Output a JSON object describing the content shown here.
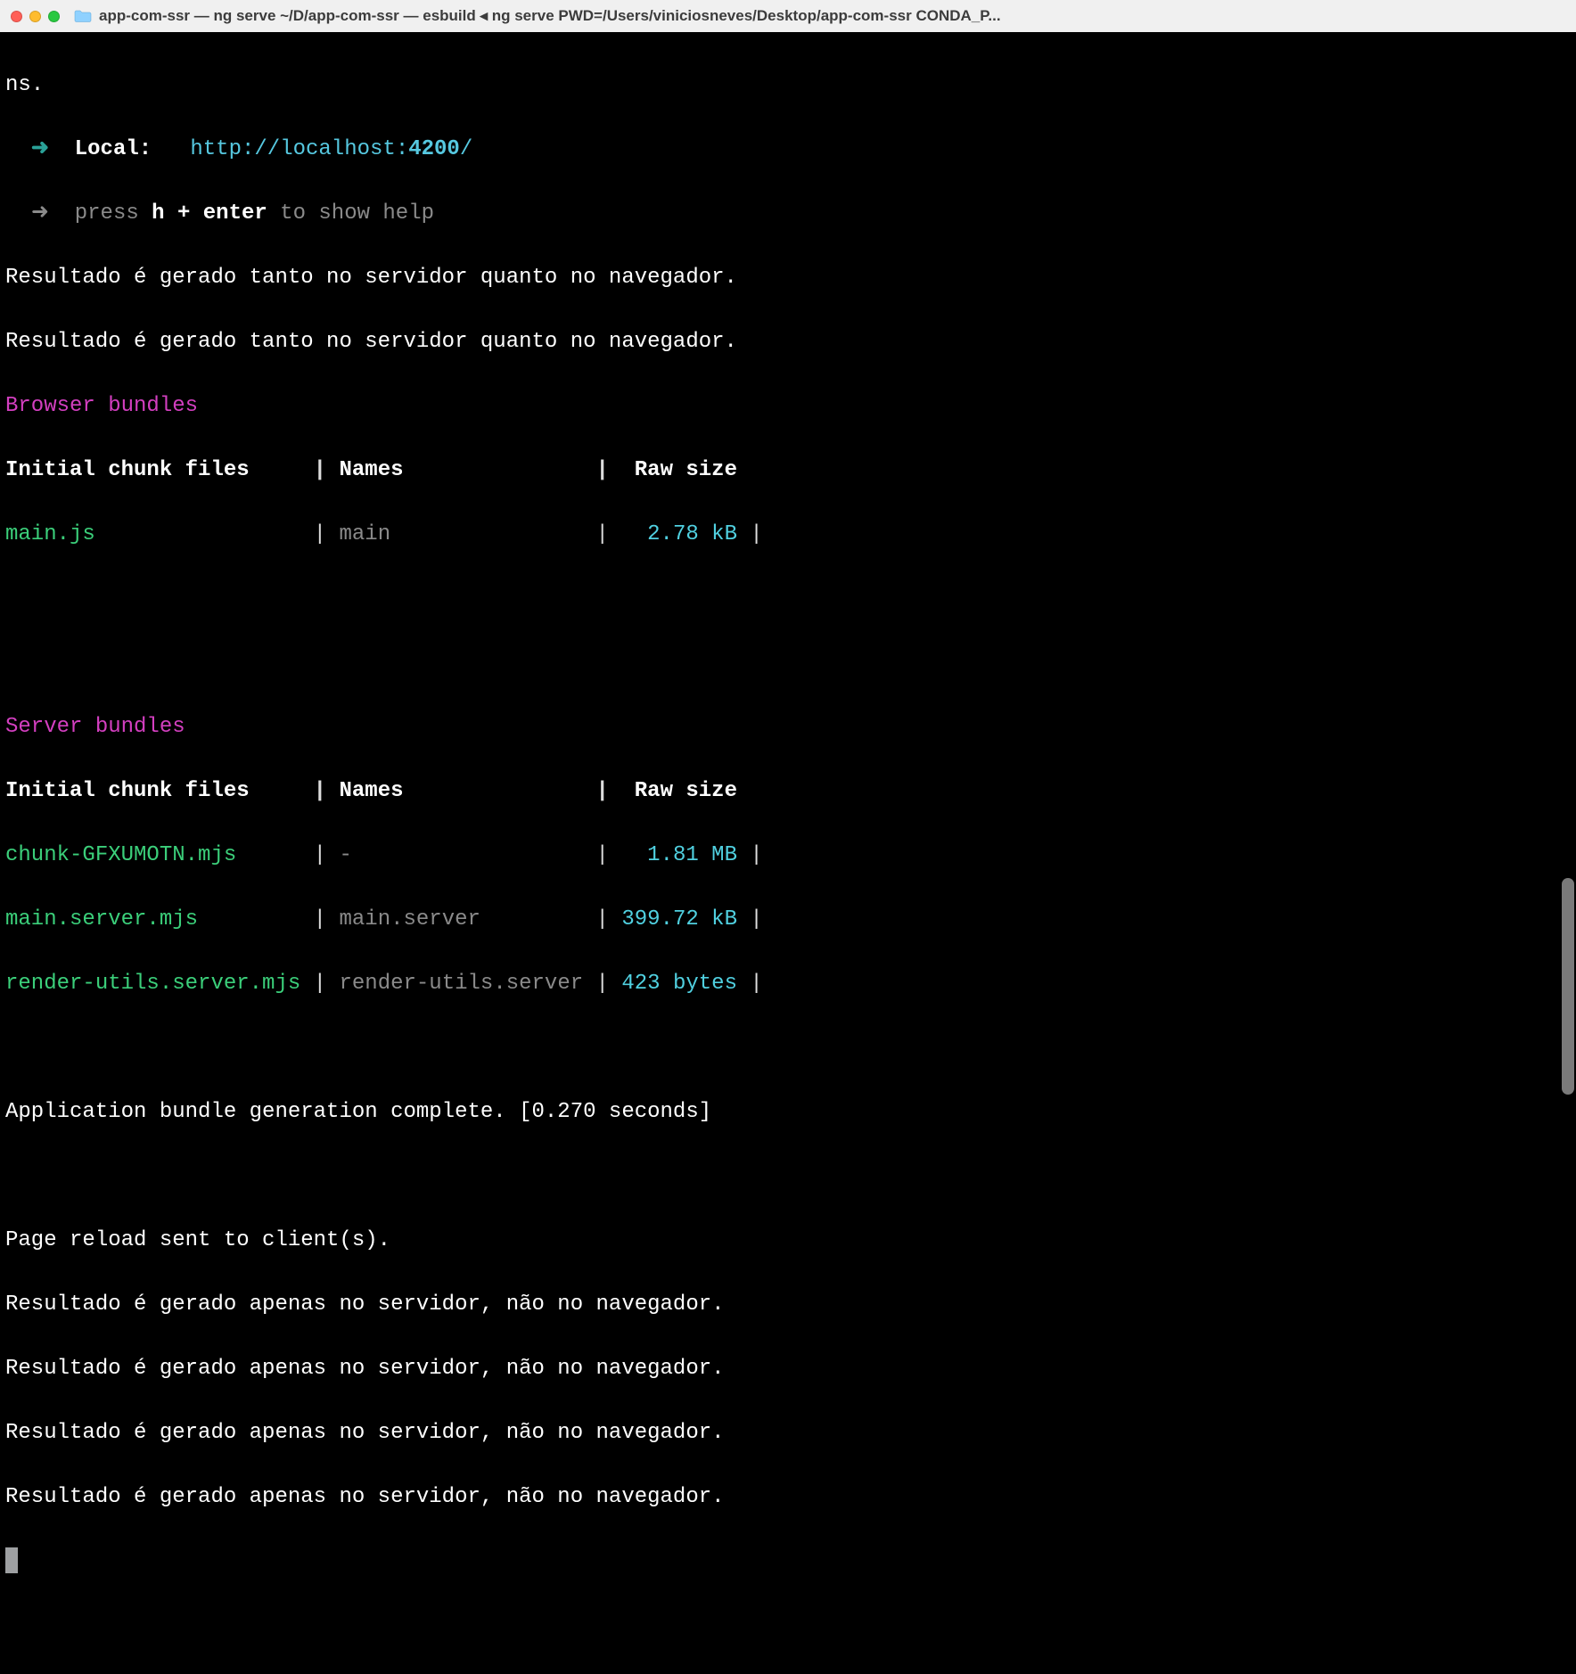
{
  "titlebar": {
    "title": "app-com-ssr — ng serve ~/D/app-com-ssr — esbuild ◂ ng serve PWD=/Users/viniciosneves/Desktop/app-com-ssr CONDA_P..."
  },
  "lines": {
    "l0": "ns.",
    "localLabel": "Local:",
    "localUrlPrefix": "http://localhost:",
    "localPort": "4200",
    "localUrlSuffix": "/",
    "press_pre": "press ",
    "press_key": "h + enter",
    "press_post": " to show help",
    "msg1": "Resultado é gerado tanto no servidor quanto no navegador.",
    "msg2": "Resultado é gerado tanto no servidor quanto no navegador.",
    "browserBundles": "Browser bundles",
    "hdr_files": "Initial chunk files",
    "hdr_names": "Names",
    "hdr_raw": "Raw size",
    "b_row1_file": "main.js",
    "b_row1_name": "main",
    "b_row1_size": "2.78 kB",
    "serverBundles": "Server bundles",
    "s_row1_file": "chunk-GFXUMOTN.mjs",
    "s_row1_name": "-",
    "s_row1_size": "1.81 MB",
    "s_row2_file": "main.server.mjs",
    "s_row2_name": "main.server",
    "s_row2_size": "399.72 kB",
    "s_row3_file": "render-utils.server.mjs",
    "s_row3_name": "render-utils.server",
    "s_row3_size": "423 bytes",
    "complete": "Application bundle generation complete. [0.270 seconds]",
    "reload": "Page reload sent to client(s).",
    "srv1": "Resultado é gerado apenas no servidor, não no navegador.",
    "srv2": "Resultado é gerado apenas no servidor, não no navegador.",
    "srv3": "Resultado é gerado apenas no servidor, não no navegador.",
    "srv4": "Resultado é gerado apenas no servidor, não no navegador."
  },
  "colors": {
    "bg": "#000000",
    "fg": "#ffffff",
    "cyan": "#56c8e0",
    "magenta": "#d33fc0",
    "green": "#3bcf7a",
    "dim": "#8a8a8a"
  }
}
